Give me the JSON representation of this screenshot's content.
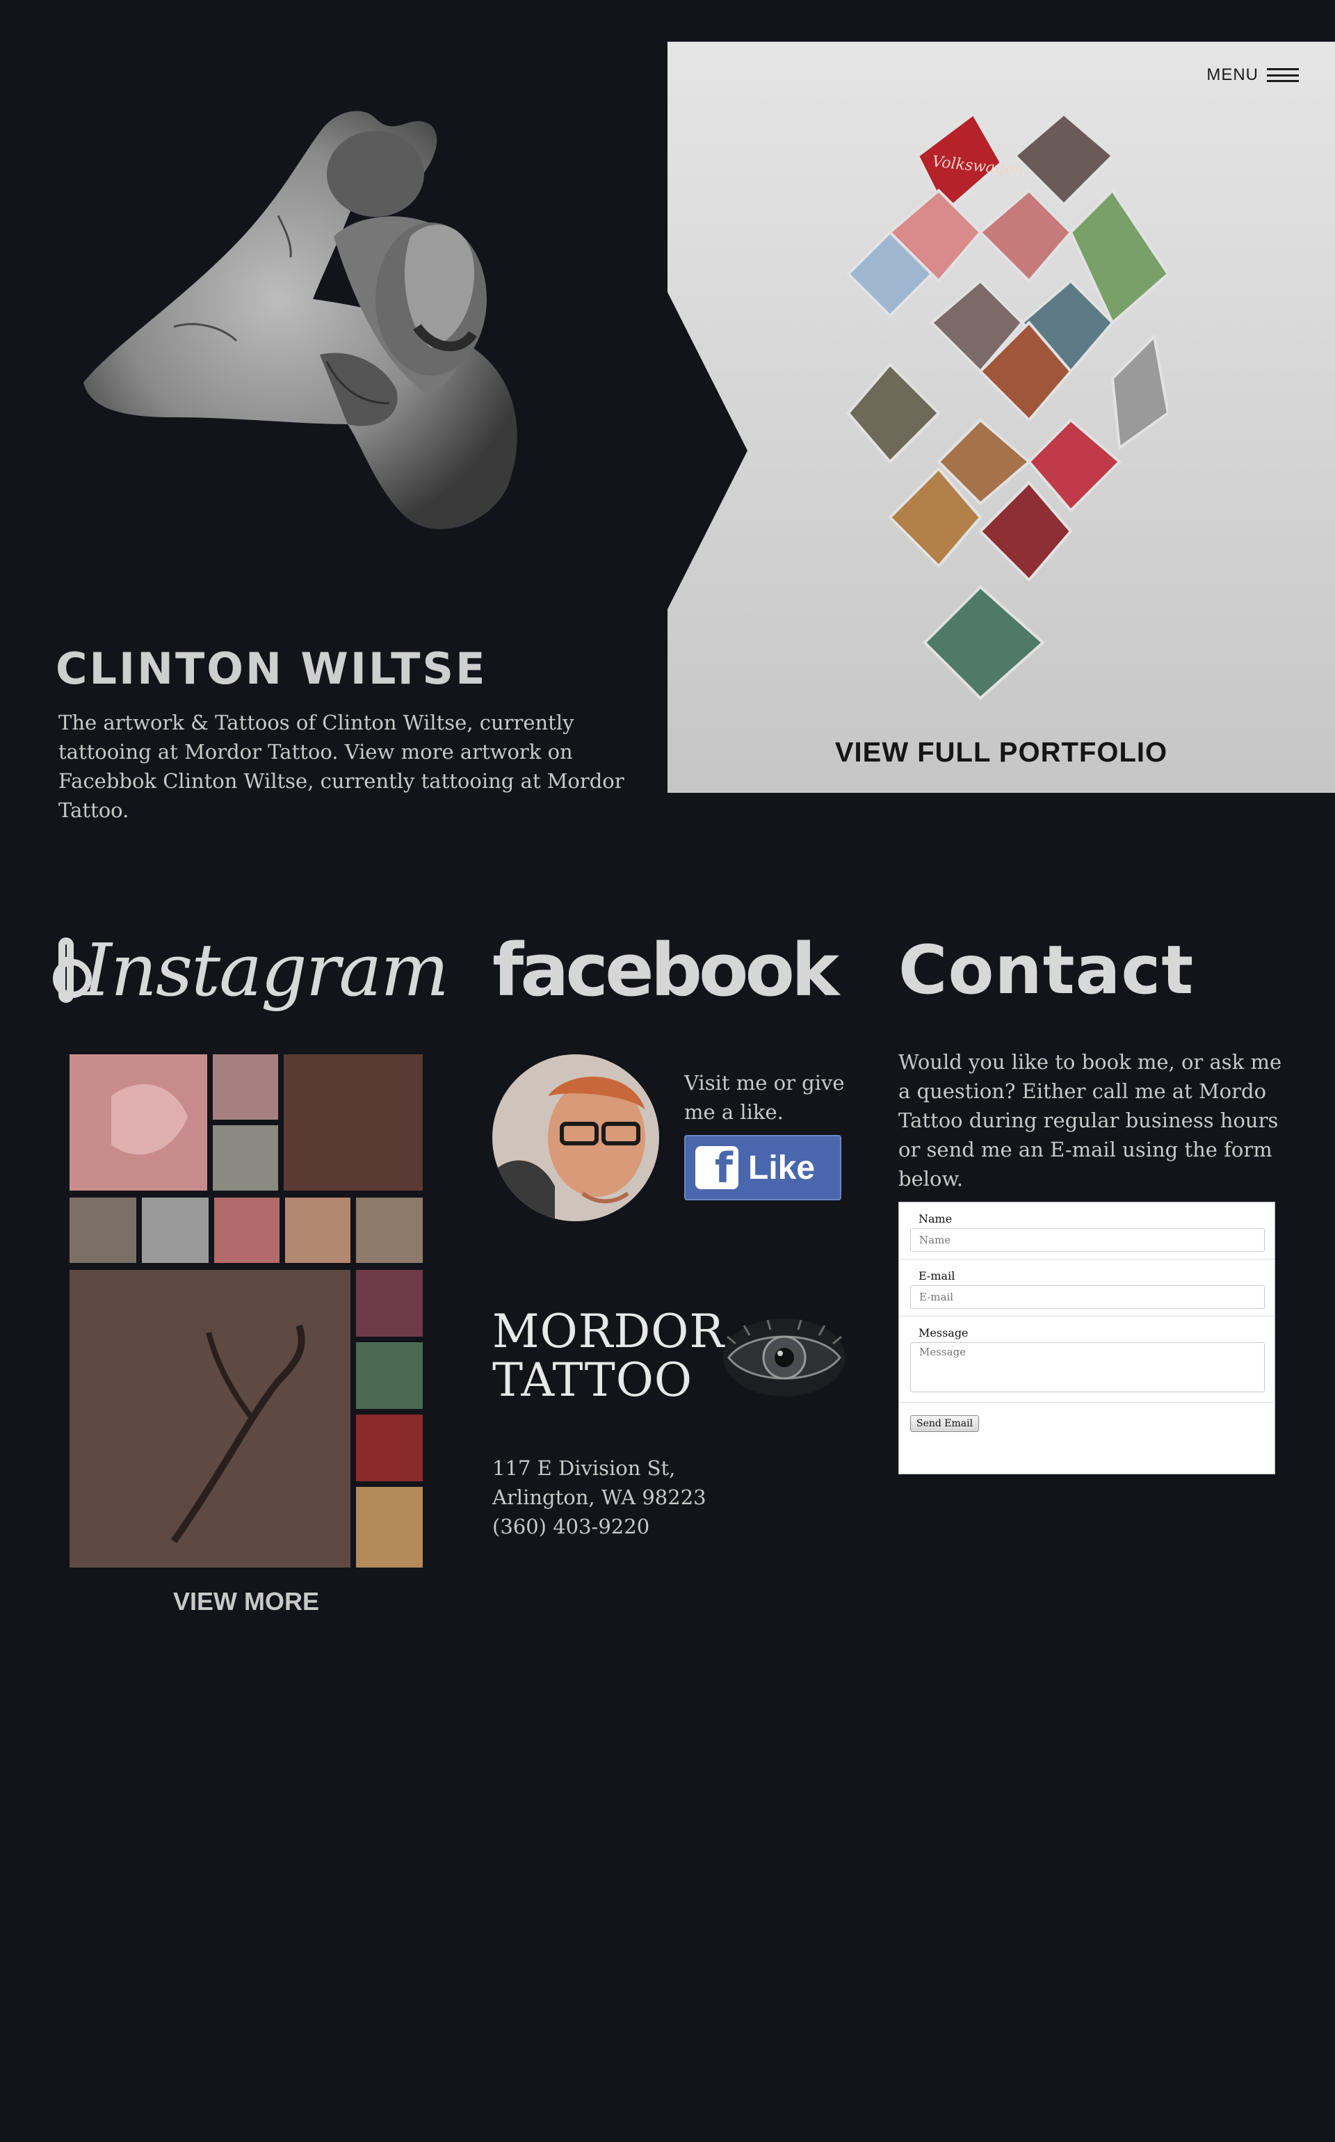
{
  "hero": {
    "name": "CLINTON WILTSE",
    "description": "The artwork & Tattoos of Clinton Wiltse, currently tattooing at Mordor Tattoo. View more artwork on Facebbok Clinton Wiltse, currently tattooing at Mordor Tattoo."
  },
  "portfolio": {
    "menu_label": "MENU",
    "menu_icon": "hamburger-icon",
    "view_label": "VIEW FULL PORTFOLIO",
    "mosaic_banner_text": "Volkswagen"
  },
  "instagram": {
    "heading": "Instagram",
    "icon": "instagram-icon",
    "view_more": "VIEW MORE"
  },
  "facebook": {
    "heading": "facebook",
    "visit_text": "Visit me or give me a like.",
    "like_icon": "facebook-f-icon",
    "like_glyph": "f",
    "like_label": "Like"
  },
  "shop": {
    "logo_line1": "MORDOR",
    "logo_line2": "TATTOO",
    "address_line1": "117 E Division St,",
    "address_line2": "Arlington, WA 98223",
    "phone": "(360) 403-9220"
  },
  "contact": {
    "heading": "Contact",
    "description": "Would you like to book  me, or ask me a question? Either call me at Mordo Tattoo during regular business hours or send me an E-mail using the form below.",
    "fields": {
      "name_label": "Name",
      "name_placeholder": "Name",
      "email_label": "E-mail",
      "email_placeholder": "E-mail",
      "message_label": "Message",
      "message_placeholder": "Message"
    },
    "send_label": "Send Email"
  },
  "colors": {
    "background": "#12141a",
    "panel_top": "#e5e5e5",
    "panel_bottom": "#c6c6c6",
    "facebook_blue": "#4a67ad"
  }
}
